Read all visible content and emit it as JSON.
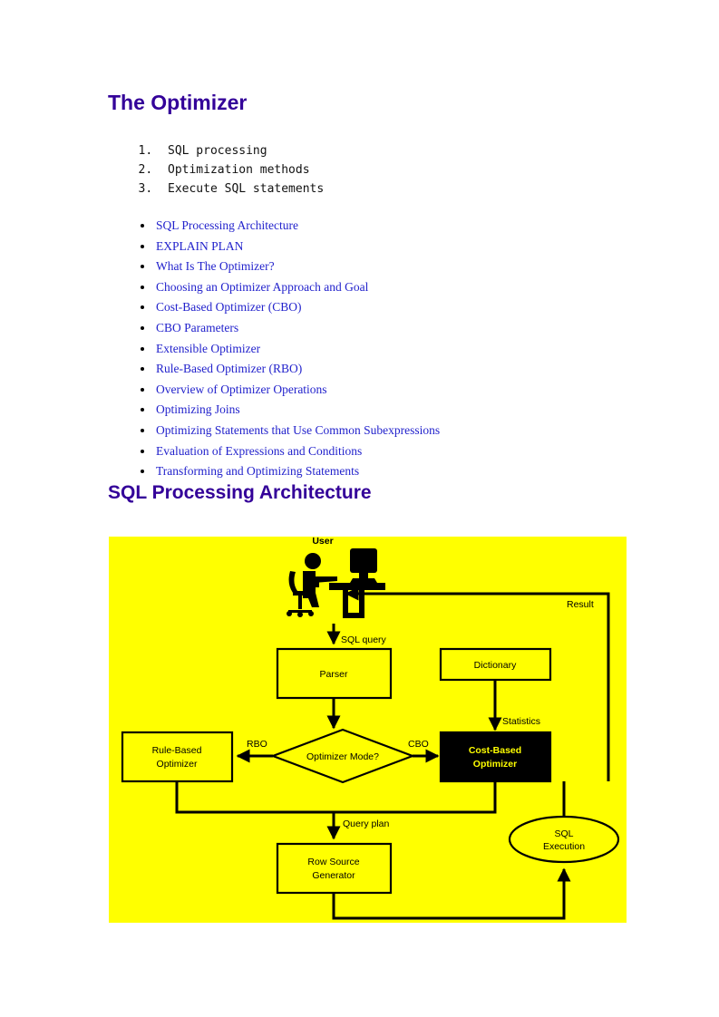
{
  "document": {
    "title": "The Optimizer",
    "title_color": "#330099",
    "section_title": "SQL Processing Architecture",
    "numbered_items": [
      "SQL processing",
      "Optimization methods",
      "Execute SQL statements"
    ],
    "bullet_links": [
      "SQL Processing Architecture",
      "EXPLAIN PLAN",
      "What Is The Optimizer?",
      "Choosing an Optimizer Approach and Goal",
      "Cost-Based Optimizer (CBO)",
      "CBO Parameters",
      "Extensible Optimizer",
      "Rule-Based Optimizer (RBO)",
      "Overview of Optimizer Operations",
      "Optimizing Joins",
      "Optimizing Statements that Use Common Subexpressions",
      "Evaluation of Expressions and Conditions",
      "Transforming and Optimizing Statements"
    ],
    "link_color": "#2222cc"
  },
  "diagram": {
    "background_color": "#ffff00",
    "stroke_color": "#000000",
    "nodes": {
      "user_label": "User",
      "parser": "Parser",
      "dictionary": "Dictionary",
      "decision": "Optimizer Mode?",
      "rule_based_line1": "Rule-Based",
      "rule_based_line2": "Optimizer",
      "cost_based_line1": "Cost-Based",
      "cost_based_line2": "Optimizer",
      "row_source_line1": "Row Source",
      "row_source_line2": "Generator",
      "sql_execution_line1": "SQL",
      "sql_execution_line2": "Execution"
    },
    "edge_labels": {
      "sql_query": "SQL query",
      "result": "Result",
      "statistics": "Statistics",
      "rbo": "RBO",
      "cbo": "CBO",
      "query_plan": "Query plan"
    }
  }
}
